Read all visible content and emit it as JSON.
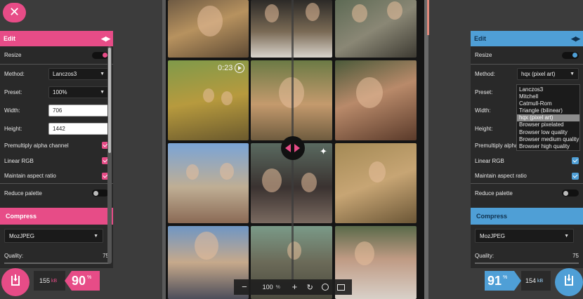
{
  "photo": {
    "video_time": "0:23"
  },
  "zoom": {
    "minus": "−",
    "value": "100",
    "unit": "%",
    "plus": "+"
  },
  "left_panel": {
    "edit_title": "Edit",
    "resize_label": "Resize",
    "method_label": "Method:",
    "method_value": "Lanczos3",
    "preset_label": "Preset:",
    "preset_value": "100%",
    "width_label": "Width:",
    "width_value": "706",
    "height_label": "Height:",
    "height_value": "1442",
    "premultiply_label": "Premultiply alpha channel",
    "linear_rgb_label": "Linear RGB",
    "aspect_label": "Maintain aspect ratio",
    "reduce_palette_label": "Reduce palette",
    "compress_title": "Compress",
    "codec_value": "MozJPEG",
    "quality_label": "Quality:",
    "quality_value": "75"
  },
  "right_panel": {
    "edit_title": "Edit",
    "resize_label": "Resize",
    "method_label": "Method:",
    "method_value": "hqx (pixel art)",
    "preset_label": "Preset:",
    "width_label": "Width:",
    "height_label": "Height:",
    "premultiply_label": "Premultiply alpha channel",
    "linear_rgb_label": "Linear RGB",
    "aspect_label": "Maintain aspect ratio",
    "reduce_palette_label": "Reduce palette",
    "compress_title": "Compress",
    "codec_value": "MozJPEG",
    "quality_label": "Quality:",
    "quality_value": "75",
    "method_options": [
      "Lanczos3",
      "Mitchell",
      "Catmull-Rom",
      "Triangle (bilinear)",
      "hqx (pixel art)",
      "Browser pixelated",
      "Browser low quality",
      "Browser medium quality",
      "Browser high quality"
    ],
    "selected_option_index": 4
  },
  "bottom": {
    "left_size": "155",
    "left_size_unit": "kB",
    "left_percent": "90",
    "left_percent_unit": "%",
    "right_size": "154",
    "right_size_unit": "kB",
    "right_percent": "91",
    "right_percent_unit": "%"
  },
  "colors": {
    "left_accent": "#e74c87",
    "right_accent": "#4f9fd6"
  },
  "icons": {
    "close": "close-icon",
    "divider": "split-handle-icon",
    "download": "download-icon"
  }
}
